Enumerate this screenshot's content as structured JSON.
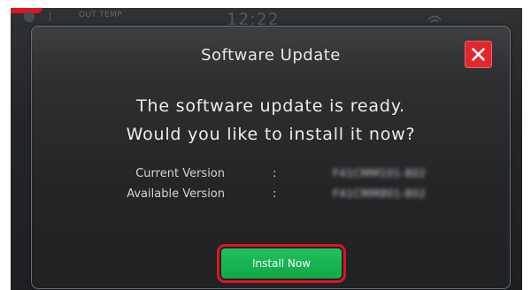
{
  "status_bar": {
    "out_temp_label": "OUT TEMP",
    "clock": "12:22",
    "left_icon": "status-circle-icon",
    "right_icon": "wifi-icon"
  },
  "dialog": {
    "title": "Software Update",
    "close_icon": "close-icon",
    "message_line1": "The software update is ready.",
    "message_line2": "Would you like to install it now?",
    "info_rows": [
      {
        "label": "Current Version",
        "separator": ":",
        "value": "F41CMM101-802"
      },
      {
        "label": "Available Version",
        "separator": ":",
        "value": "F41CMM801-802"
      }
    ],
    "install_button_label": "Install Now"
  },
  "colors": {
    "close_button": "#e2262e",
    "install_button": "#17b052",
    "highlight": "#e0141e",
    "background": "#232527"
  }
}
